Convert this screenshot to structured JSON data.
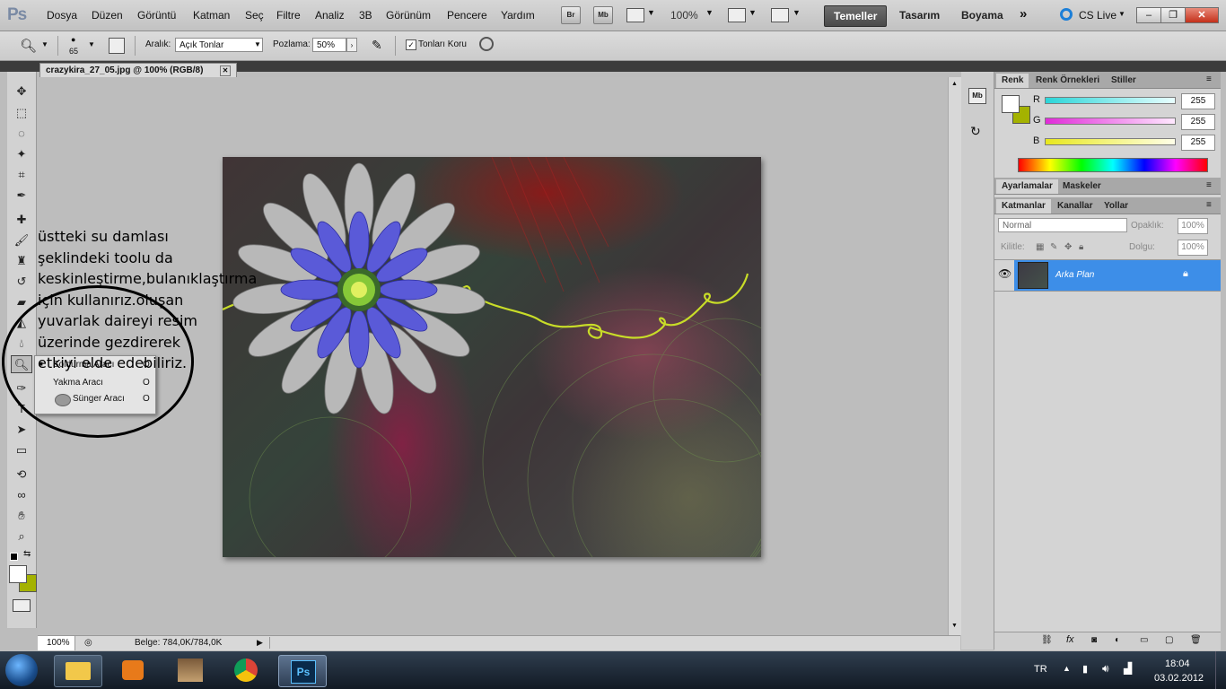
{
  "app": {
    "logo": "Ps"
  },
  "menu": [
    "Dosya",
    "Düzen",
    "Görüntü",
    "Katman",
    "Seç",
    "Filtre",
    "Analiz",
    "3B",
    "Görünüm",
    "Pencere",
    "Yardım"
  ],
  "menu_buttons": {
    "bridge": "Br",
    "minibridge": "Mb",
    "zoom": "100%"
  },
  "workspaces": [
    "Temeller",
    "Tasarım",
    "Boyama"
  ],
  "cs_live": "CS Live",
  "options": {
    "brush_size": "65",
    "range_label": "Aralık:",
    "range_value": "Açık Tonlar",
    "exposure_label": "Pozlama:",
    "exposure_value": "50%",
    "protect_tones": "Tonları Koru"
  },
  "document": {
    "tab_title": "crazykira_27_05.jpg @ 100% (RGB/8)",
    "zoom": "100%",
    "info": "Belge: 784,0K/784,0K"
  },
  "tool_flyout": {
    "items": [
      "Soldurma Aracı",
      "Yakma Aracı",
      "Sünger Aracı"
    ],
    "shortcut": "O"
  },
  "annotation": "üstteki su damlası şeklindeki toolu da keskinleştirme,bulanıklaştırma için kullanırız.oluşan yuvarlak daireyi resim üzerinde gezdirerek etkiyi elde edebiliriz.",
  "color_panel": {
    "tabs": [
      "Renk",
      "Renk Örnekleri",
      "Stiller"
    ],
    "channels": [
      {
        "label": "R",
        "value": "255"
      },
      {
        "label": "G",
        "value": "255"
      },
      {
        "label": "B",
        "value": "255"
      }
    ],
    "fg_color": "#ffffff",
    "bg_color": "#a4b200"
  },
  "adjust_panel": {
    "tabs": [
      "Ayarlamalar",
      "Maskeler"
    ]
  },
  "layers_panel": {
    "tabs": [
      "Katmanlar",
      "Kanallar",
      "Yollar"
    ],
    "blend_mode": "Normal",
    "opacity_label": "Opaklık:",
    "opacity_value": "100%",
    "lock_label": "Kilitle:",
    "fill_label": "Dolgu:",
    "fill_value": "100%",
    "layer_name": "Arka Plan"
  },
  "taskbar": {
    "lang": "TR",
    "time": "18:04",
    "date": "03.02.2012"
  },
  "colors": {
    "layer_selected": "#3d8ee8",
    "accent_cyan": "#2bd5d8",
    "accent_magenta": "#e02bd8",
    "accent_yellow": "#e8e81e"
  }
}
